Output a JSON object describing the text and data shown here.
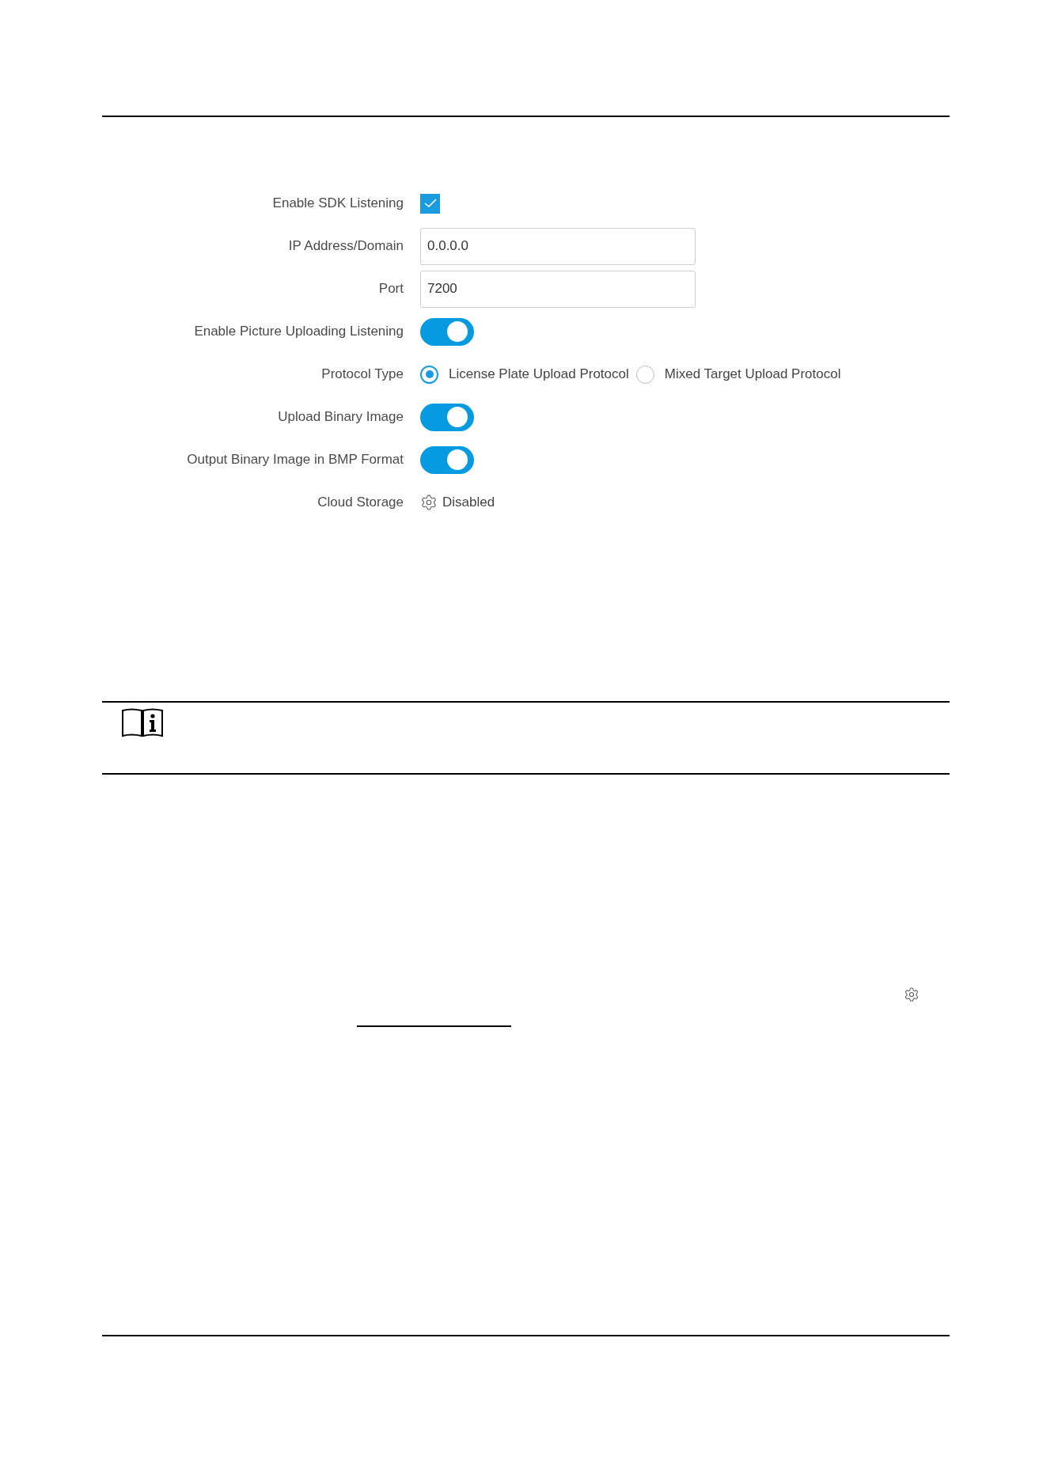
{
  "form": {
    "fields": [
      {
        "kind": "checkbox",
        "label": "Enable SDK Listening",
        "checked": true
      },
      {
        "kind": "input",
        "label": "IP Address/Domain",
        "value": "0.0.0.0"
      },
      {
        "kind": "input",
        "label": "Port",
        "value": "7200"
      },
      {
        "kind": "toggle",
        "label": "Enable Picture Uploading Listening",
        "on": true
      },
      {
        "kind": "radio",
        "label": "Protocol Type",
        "options": [
          {
            "label": "License Plate Upload Protocol",
            "selected": true
          },
          {
            "label": "Mixed Target Upload Protocol",
            "selected": false
          }
        ]
      },
      {
        "kind": "toggle",
        "label": "Upload Binary Image",
        "on": true
      },
      {
        "kind": "toggle",
        "label": "Output Binary Image in BMP Format",
        "on": true
      },
      {
        "kind": "status",
        "label": "Cloud Storage",
        "value": "Disabled"
      }
    ]
  }
}
